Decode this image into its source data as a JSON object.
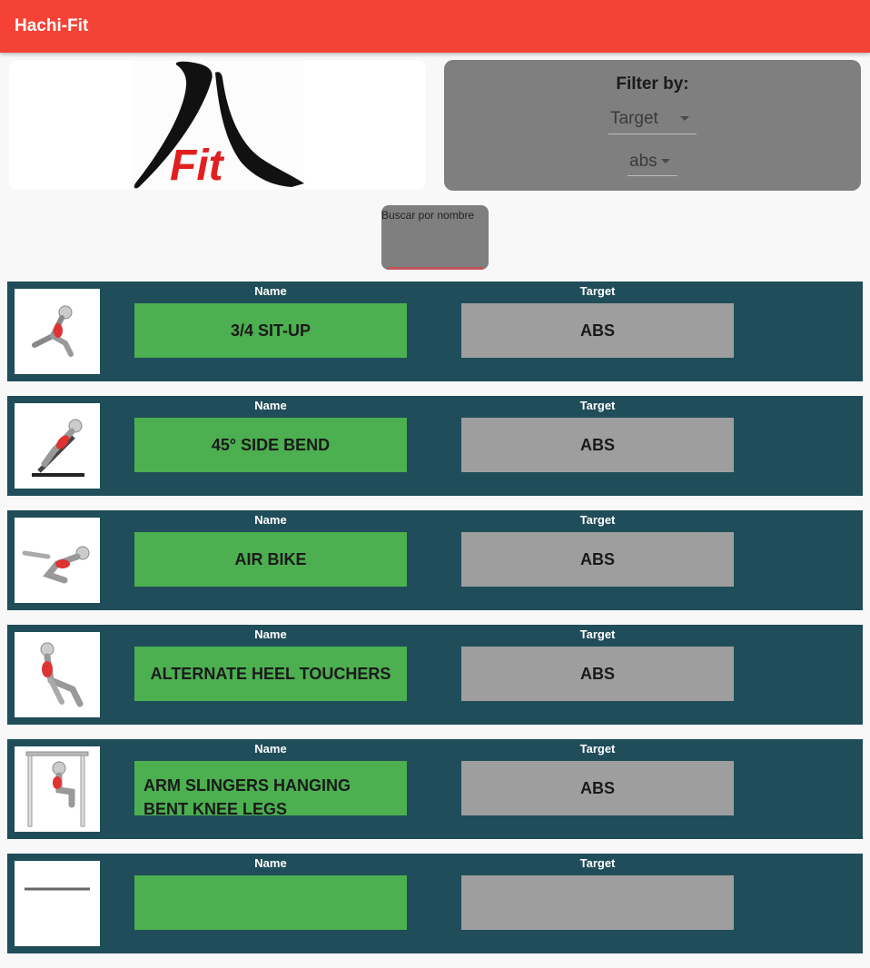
{
  "appbar": {
    "title": "Hachi-Fit"
  },
  "logo": {
    "text": "Fit",
    "colors": {
      "brush": "#111111",
      "fit": "#e02020"
    }
  },
  "filter": {
    "title": "Filter by:",
    "field_value": "Target",
    "value_value": "abs"
  },
  "search": {
    "label": "Buscar por nombre",
    "value": ""
  },
  "columns": {
    "name": "Name",
    "target": "Target"
  },
  "exercises": [
    {
      "name": "3/4 SIT-UP",
      "target": "ABS",
      "image_icon": "situp-figure-icon"
    },
    {
      "name": "45° SIDE BEND",
      "target": "ABS",
      "image_icon": "side-bend-figure-icon"
    },
    {
      "name": "AIR BIKE",
      "target": "ABS",
      "image_icon": "air-bike-figure-icon"
    },
    {
      "name": "ALTERNATE HEEL TOUCHERS",
      "target": "ABS",
      "image_icon": "heel-touchers-figure-icon"
    },
    {
      "name": "ARM SLINGERS HANGING BENT KNEE LEGS",
      "target": "ABS",
      "image_icon": "hanging-figure-icon"
    },
    {
      "name": "",
      "target": "",
      "image_icon": "exercise-figure-icon"
    }
  ],
  "colors": {
    "appbar": "#f44336",
    "row_bg": "#1f4d59",
    "name_bg": "#4caf50",
    "target_bg": "#9e9e9e",
    "filter_bg": "#7f7f7f"
  }
}
